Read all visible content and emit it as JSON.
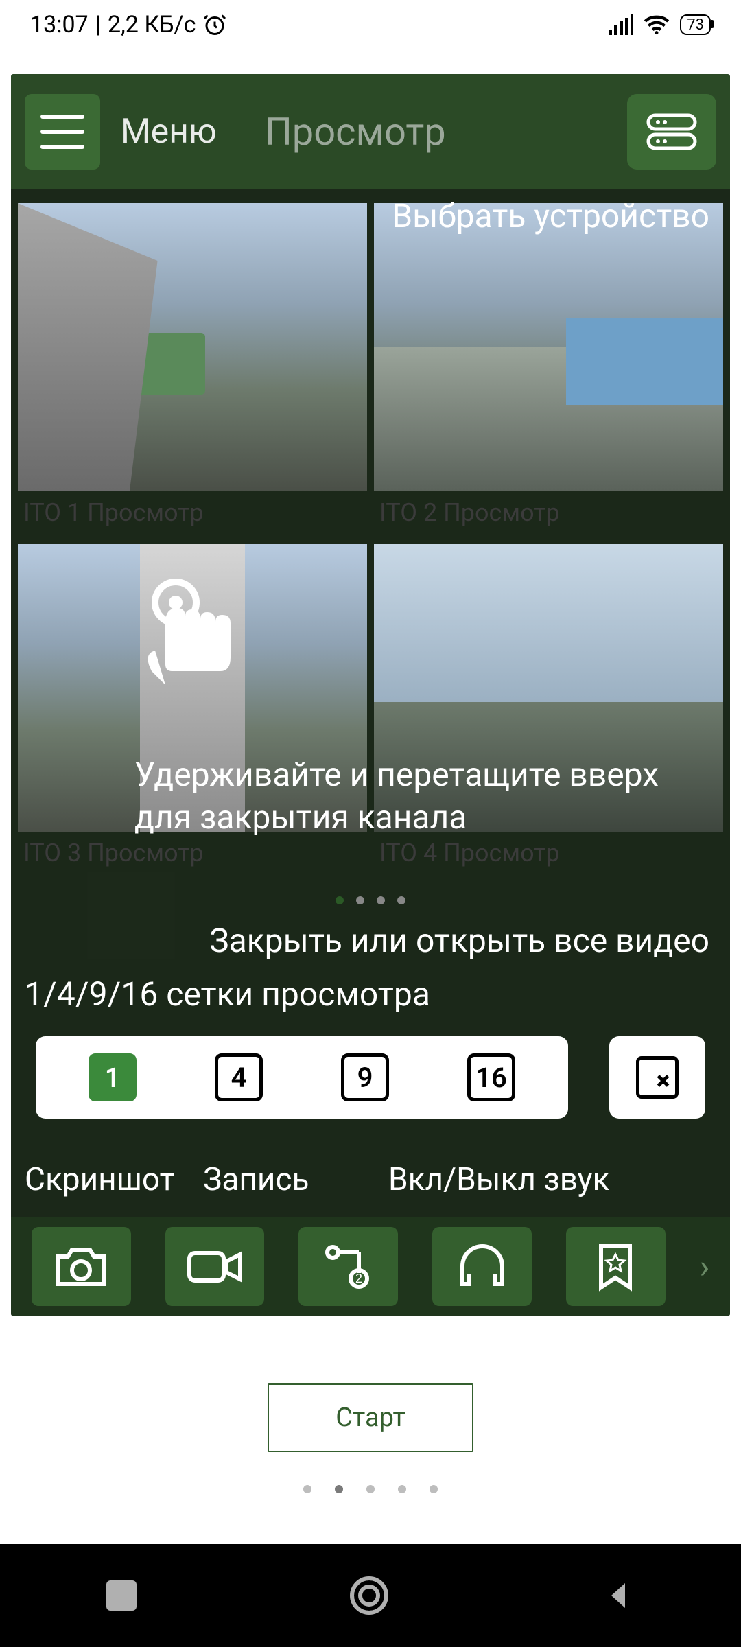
{
  "status": {
    "time": "13:07",
    "sep": "|",
    "net_speed": "2,2 КБ/с",
    "battery_pct": "73"
  },
  "header": {
    "menu_label": "Меню",
    "title": "Просмотр"
  },
  "cameras": [
    {
      "label": "ITO 1  Просмотр"
    },
    {
      "label": "ITO 2  Просмотр"
    },
    {
      "label": "ITO 3  Просмотр"
    },
    {
      "label": "ITO 4  Просмотр"
    }
  ],
  "overlay": {
    "select_device": "Выбрать устройство",
    "hold_drag": "Удерживайте и перетащите вверх для закрытия канала",
    "close_open_all": "Закрыть или открыть все видео",
    "grid_label": "1/4/9/16 сетки просмотра",
    "screenshot": "Скриншот",
    "record": "Запись",
    "sound_toggle": "Вкл/Выкл звук"
  },
  "grid_sizes": {
    "n1": "1",
    "n4": "4",
    "n9": "9",
    "n16": "16"
  },
  "start_button": "Старт"
}
